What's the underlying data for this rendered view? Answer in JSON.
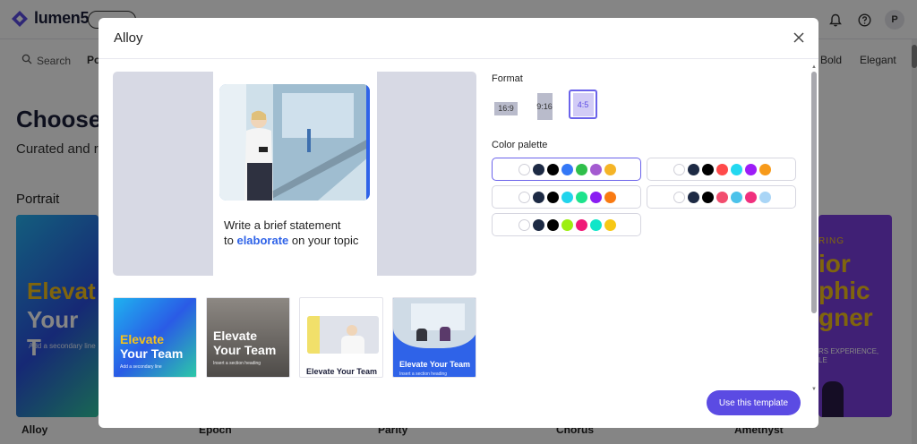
{
  "app": {
    "logo_text": "lumen5",
    "avatar_initial": "P",
    "icons": [
      "bell-icon",
      "help-icon"
    ]
  },
  "filters": {
    "search_label": "Search",
    "active_chip": "Po",
    "right_chips": [
      "Bold",
      "Elegant"
    ]
  },
  "page": {
    "title": "Choose",
    "subtitle": "Curated and r",
    "section": "Portrait",
    "cards": [
      {
        "name": "Alloy",
        "headline_1": "Elevat",
        "headline_2": "Your T",
        "caption": "Add a secondary line"
      },
      {
        "name": "Epoch"
      },
      {
        "name": "Parity"
      },
      {
        "name": "Chorus"
      },
      {
        "name": "Amethyst",
        "top_text": "RING",
        "line_1": "ior",
        "line_2": "phic",
        "line_3": "gner",
        "caption_1": "RS EXPERIENCE,",
        "caption_2": "LE"
      }
    ]
  },
  "modal": {
    "title": "Alloy",
    "preview": {
      "text_line_1": "Write a brief statement",
      "text_prefix": "to ",
      "text_highlight": "elaborate",
      "text_suffix": " on your topic"
    },
    "thumbnails": [
      {
        "line_1": "Elevate",
        "line_2": "Your Team",
        "caption": "Add a secondary line"
      },
      {
        "line_1": "Elevate",
        "line_2": "Your Team",
        "caption": "Insert a section heading"
      },
      {
        "title": "Elevate Your Team"
      },
      {
        "title": "Elevate Your Team",
        "caption": "Insert a section heading"
      }
    ],
    "format_label": "Format",
    "formats": [
      {
        "label": "16:9",
        "selected": false
      },
      {
        "label": "9:16",
        "selected": false
      },
      {
        "label": "4:5",
        "selected": true
      }
    ],
    "palette_label": "Color palette",
    "palettes": [
      {
        "selected": true,
        "colors": [
          "#ffffff",
          "#1d2a44",
          "#000000",
          "#3478f6",
          "#2fbf4a",
          "#a45bd0",
          "#f5b426"
        ]
      },
      {
        "selected": false,
        "colors": [
          "#ffffff",
          "#1d2a44",
          "#000000",
          "#ff4a4a",
          "#23d8f0",
          "#9d1df7",
          "#f79a1a"
        ]
      },
      {
        "selected": false,
        "colors": [
          "#ffffff",
          "#1d2a44",
          "#000000",
          "#21d4ec",
          "#1de38c",
          "#8a1df2",
          "#f97a12"
        ]
      },
      {
        "selected": false,
        "colors": [
          "#ffffff",
          "#1d2a44",
          "#000000",
          "#f24d6e",
          "#4bc2ea",
          "#f0307e",
          "#a9d5f6"
        ]
      },
      {
        "selected": false,
        "colors": [
          "#ffffff",
          "#1d2a44",
          "#000000",
          "#9cef10",
          "#f01a78",
          "#10e6c9",
          "#f7c815"
        ]
      }
    ],
    "cta_label": "Use this template"
  }
}
